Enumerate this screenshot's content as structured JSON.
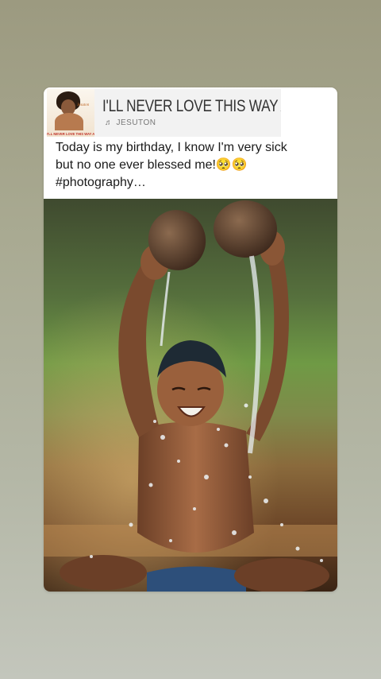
{
  "music_sticker": {
    "title": "I'LL NEVER LOVE THIS WAY A",
    "artist": "JESUTON",
    "album_caption": "I'LL NEVER LOVE THIS WAY AGAIN",
    "album_brand": "Jesuton",
    "icon": "music-note-icon"
  },
  "post": {
    "caption": "Today is my birthday, I know I'm very sick\nbut no one ever blessed me!🥺🥺\n#photography…"
  },
  "colors": {
    "background_top": "#9c9a80",
    "background_bottom": "#c3c6bc",
    "card": "#ffffff"
  }
}
